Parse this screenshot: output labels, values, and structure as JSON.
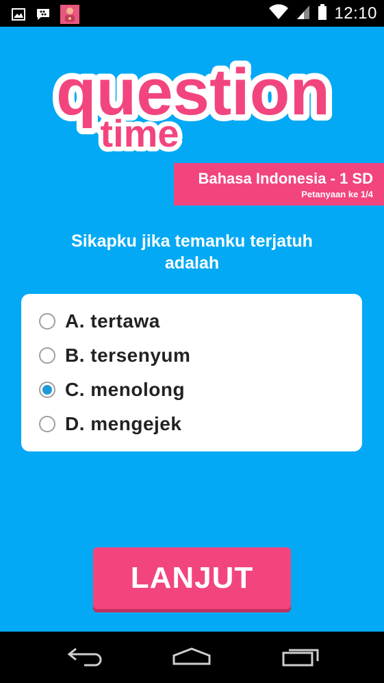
{
  "status_bar": {
    "time": "12:10",
    "icons": [
      "image-icon",
      "bbm-icon",
      "app-avatar-icon",
      "wifi-icon",
      "signal-icon",
      "battery-icon"
    ]
  },
  "logo": {
    "word1": "question",
    "word2": "time",
    "color": "#F2457E"
  },
  "subject": {
    "title": "Bahasa Indonesia - 1 SD",
    "progress": "Petanyaan ke 1/4"
  },
  "question": {
    "line1": "Sikapku jika temanku terjatuh",
    "line2": "adalah"
  },
  "options": [
    {
      "label": "A. tertawa",
      "selected": false
    },
    {
      "label": "B. tersenyum",
      "selected": false
    },
    {
      "label": "C. menolong",
      "selected": true
    },
    {
      "label": "D. mengejek",
      "selected": false
    }
  ],
  "next_button": {
    "label": "LANJUT"
  },
  "nav": [
    "back-icon",
    "home-icon",
    "recents-icon"
  ],
  "colors": {
    "background": "#03A9F4",
    "accent": "#F2457E",
    "radio_selected": "#1E9AD6"
  }
}
